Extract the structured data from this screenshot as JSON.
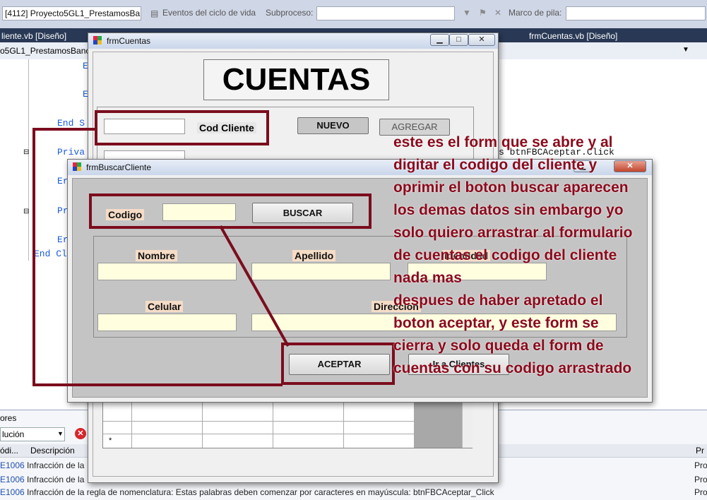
{
  "toolbar": {
    "process_combo": "[4112] Proyecto5GL1_PrestamosBa",
    "lifecycle_label": "Eventos del ciclo de vida",
    "subprocess_label": "Subproceso:",
    "stackframe_label": "Marco de pila:"
  },
  "tabs": {
    "left": "liente.vb [Diseño]",
    "right": "frmCuentas.vb [Diseño]"
  },
  "navbar": {
    "project": "o5GL1_PrestamosBanca"
  },
  "code": {
    "end_sub": "End S",
    "priva": "Priva",
    "end_c": "End Cl",
    "pri": "Pri",
    "btn_click": "s btnFBCAceptar.Click",
    "e1": "E",
    "e2": "E",
    "e3": "Er",
    "e4": "Er"
  },
  "errors": {
    "header": "ores",
    "filter": "lución",
    "col_code": "ódi...",
    "col_desc": "Descripción",
    "col_proj": "Pr",
    "rows": [
      {
        "code": "E1006",
        "desc": "Infracción de la",
        "proj": "Pro"
      },
      {
        "code": "E1006",
        "desc": "Infracción de la",
        "proj": "Pro"
      },
      {
        "code": "E1006",
        "desc": "Infracción de la regla de nomenclatura: Estas palabras deben comenzar por caracteres en mayúscula: btnFBCAceptar_Click",
        "proj": "Pro"
      }
    ]
  },
  "frmCuentas": {
    "title": "frmCuentas",
    "header": "CUENTAS",
    "cod_cliente_label": "Cod Cliente",
    "nuevo": "NUEVO",
    "agregar": "AGREGAR"
  },
  "frmBuscarCliente": {
    "title": "frmBuscarCliente",
    "codigo_label": "Codigo",
    "buscar": "BUSCAR",
    "nombre": "Nombre",
    "apellido": "Apellido",
    "identidad": "Identidad",
    "celular": "Celular",
    "direccion": "Direccion",
    "aceptar": "ACEPTAR",
    "ir_clientes": "Ir a Clientes"
  },
  "annotation": {
    "lines": [
      "este es el form que se abre y al",
      "digitar el codigo del cliente y",
      "oprimir el boton buscar aparecen",
      "los demas datos sin embargo yo",
      "solo quiero arrastrar al formulario",
      "de cuentas el codigo del cliente",
      "nada mas",
      " despues de haber apretado el",
      " boton aceptar, y este form se",
      "cierra y solo queda el form de",
      "cuentas con su codigo arrastrado"
    ]
  },
  "colors": {
    "annotation": "#8b0a1c",
    "vs_tabstrip": "#293955",
    "textbox_fill": "#ffffe0",
    "label_fill": "#f5dcc6"
  }
}
